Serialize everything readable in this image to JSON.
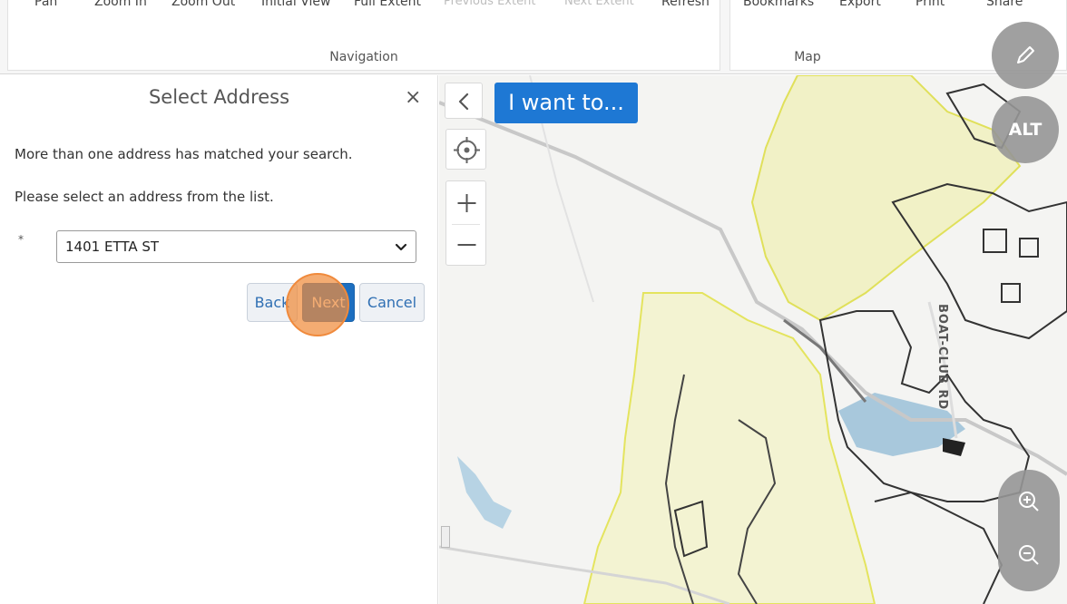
{
  "ribbon": {
    "navigation": {
      "label": "Navigation",
      "tools": [
        {
          "label": "Pan",
          "enabled": true
        },
        {
          "label": "Zoom In",
          "enabled": true
        },
        {
          "label": "Zoom Out",
          "enabled": true
        },
        {
          "label": "Initial View",
          "enabled": true
        },
        {
          "label": "Full Extent",
          "enabled": true
        },
        {
          "label": "Previous Extent",
          "enabled": false
        },
        {
          "label": "Next Extent",
          "enabled": false
        },
        {
          "label": "Refresh",
          "enabled": true
        }
      ]
    },
    "map": {
      "label": "Map",
      "tools": [
        {
          "label": "Bookmarks"
        },
        {
          "label": "Export"
        },
        {
          "label": "Print"
        },
        {
          "label": "Share"
        }
      ]
    }
  },
  "panel": {
    "title": "Select Address",
    "close_label": "×",
    "message_1": "More than one address has matched your search.",
    "message_2": "Please select an address from the list.",
    "required_marker": "*",
    "address_select": {
      "selected": "1401 ETTA ST"
    },
    "buttons": {
      "back": "Back",
      "next": "Next",
      "cancel": "Cancel"
    }
  },
  "map": {
    "i_want_to_label": "I want to...",
    "alt_label": "ALT",
    "road_label": "BOAT-CLUB RD",
    "colors": {
      "accent": "#1e78d4",
      "yellow_zone": "#f2f2c4",
      "boundary": "#2f2f2f",
      "water": "#a8c8dc"
    }
  },
  "icons": {
    "collapse": "chevron-left-icon",
    "locate": "crosshair-icon",
    "zoom_in": "plus-icon",
    "zoom_out": "minus-icon",
    "edit": "pencil-icon",
    "map_zoom_in": "magnify-plus-icon",
    "map_zoom_out": "magnify-minus-icon",
    "select_chevron": "chevron-down-icon"
  }
}
